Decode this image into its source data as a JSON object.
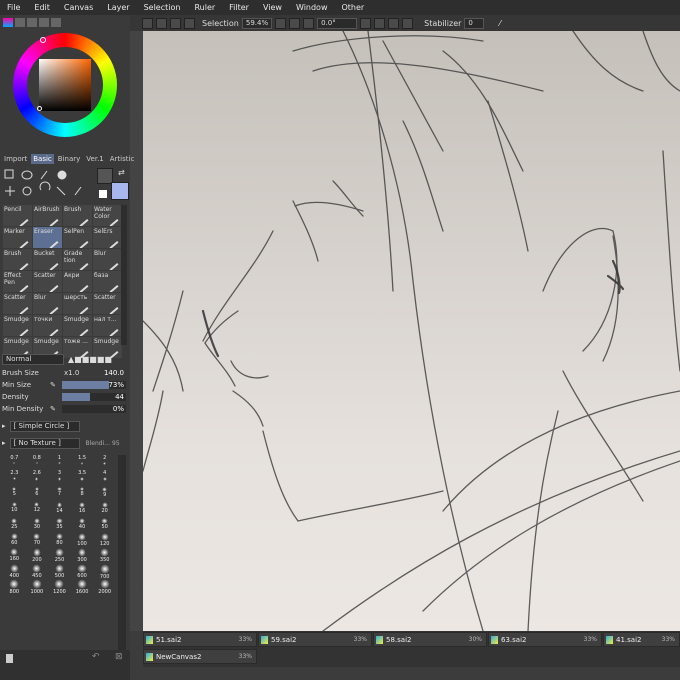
{
  "menu": [
    "File",
    "Edit",
    "Canvas",
    "Layer",
    "Selection",
    "Ruler",
    "Filter",
    "View",
    "Window",
    "Other"
  ],
  "toolbar": {
    "selection_label": "Selection",
    "zoom": "59.4%",
    "angle": "0.0°",
    "stabilizer_label": "Stabilizer",
    "stabilizer_value": "0"
  },
  "panel_tabs": [
    "Import",
    "Basic",
    "Binary",
    "Ver.1",
    "Artistic"
  ],
  "brushes": [
    "Pencil",
    "AirBrush",
    "Brush",
    "Water Color",
    "Marker",
    "Eraser",
    "SelPen",
    "SelErs",
    "Brush",
    "Bucket",
    "Grade tion",
    "Blur",
    "Effect Pen",
    "Scatter",
    "Акри",
    "база",
    "Scatter",
    "Blur",
    "шерсть",
    "Scatter",
    "Smudge",
    "точки",
    "Smudge",
    "нал т...",
    "Smudge",
    "Smudge",
    "тоже ...",
    "Smudge"
  ],
  "blend_mode": "Normal",
  "props": {
    "size_label": "Brush Size",
    "size_mult": "x1.0",
    "size_value": "140.0",
    "minsize_label": "Min Size",
    "minsize_value": "73%",
    "minsize_pct": 73,
    "density_label": "Density",
    "density_value": "44",
    "density_pct": 44,
    "mindensity_label": "Min Density",
    "mindensity_value": "0%",
    "mindensity_pct": 0
  },
  "shape": "[ Simple Circle ]",
  "texture": "[ No Texture ]",
  "blending": "Blendi...",
  "blending_val": "95",
  "sizes": [
    "0.7",
    "0.8",
    "1",
    "1.5",
    "2",
    "2.3",
    "2.6",
    "3",
    "3.5",
    "4",
    "5",
    "6",
    "7",
    "8",
    "9",
    "10",
    "12",
    "14",
    "16",
    "20",
    "25",
    "30",
    "35",
    "40",
    "50",
    "60",
    "70",
    "80",
    "100",
    "120",
    "160",
    "200",
    "250",
    "300",
    "350",
    "400",
    "450",
    "500",
    "600",
    "700",
    "800",
    "1000",
    "1200",
    "1600",
    "2000"
  ],
  "files": [
    {
      "name": "51.sai2",
      "zoom": "33%"
    },
    {
      "name": "59.sai2",
      "zoom": "33%"
    },
    {
      "name": "58.sai2",
      "zoom": "30%"
    },
    {
      "name": "63.sai2",
      "zoom": "33%"
    },
    {
      "name": "41.sai2",
      "zoom": "33%"
    },
    {
      "name": "NewCanvas2",
      "zoom": "33%"
    }
  ],
  "colors": {
    "accent": "#5d6f92",
    "fg": "#555555",
    "bg": "#a8b6f0"
  }
}
